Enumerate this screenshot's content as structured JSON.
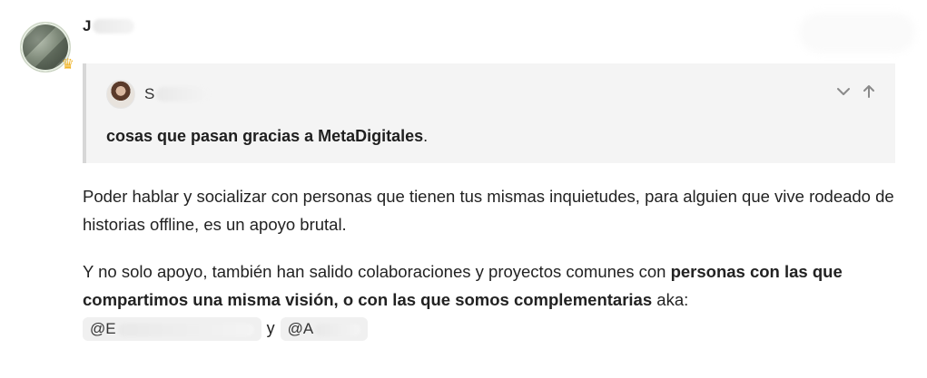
{
  "post": {
    "author": {
      "name_prefix": "J",
      "badge_icon": "crown-icon"
    },
    "quote": {
      "author_prefix": "S",
      "text_bold": "cosas que pasan gracias a MetaDigitales",
      "text_tail": ".",
      "controls": {
        "collapse_icon": "chevron-down-icon",
        "jump_icon": "arrow-up-icon"
      }
    },
    "paragraph1": "Poder hablar y socializar con personas que tienen tus mismas inquietudes, para alguien que vive rodeado de historias offline, es un apoyo brutal.",
    "paragraph2": {
      "text_start": "Y no solo apoyo, también han salido colaboraciones y proyectos comunes con ",
      "text_bold": "personas con las que compartimos una misma visión, o con las que somos complementarias",
      "text_end": " aka: ",
      "mentions": [
        {
          "prefix": "@E"
        },
        {
          "prefix": "@A"
        }
      ],
      "mention_separator": "y"
    }
  }
}
